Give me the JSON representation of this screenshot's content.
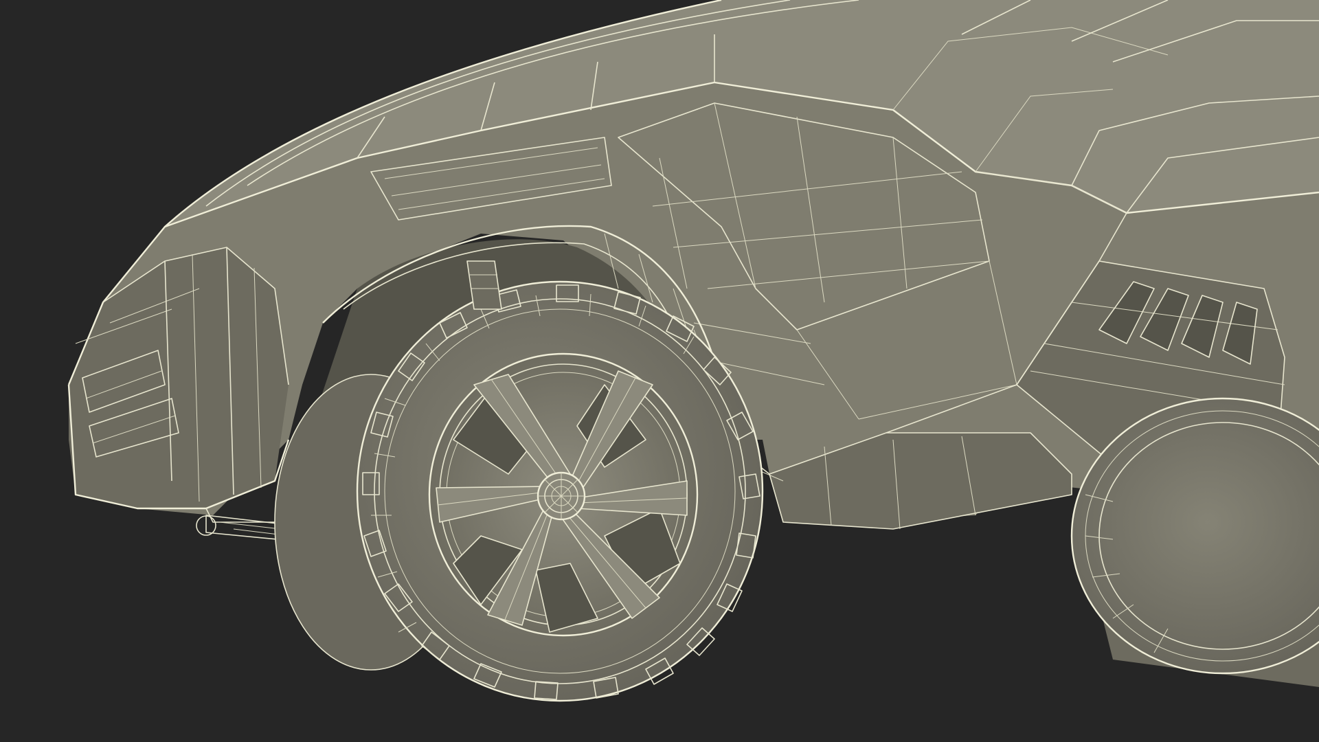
{
  "scene": {
    "background_color": "#262626",
    "model_fill_color": "#7f7d6f",
    "wireframe_color": "#e8e6cf",
    "subject": "wireframe-render-of-futuristic-vehicle-front-wheel"
  }
}
